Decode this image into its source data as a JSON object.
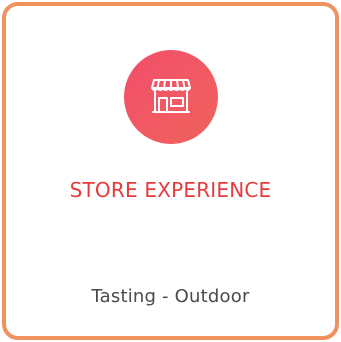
{
  "card": {
    "icon": "store-icon",
    "title": "STORE EXPERIENCE",
    "subtitle": "Tasting - Outdoor",
    "colors": {
      "border": "#f0925e",
      "icon_background": "#f24e6b",
      "title": "#e63b3b",
      "subtitle": "#4a4a4a"
    }
  }
}
